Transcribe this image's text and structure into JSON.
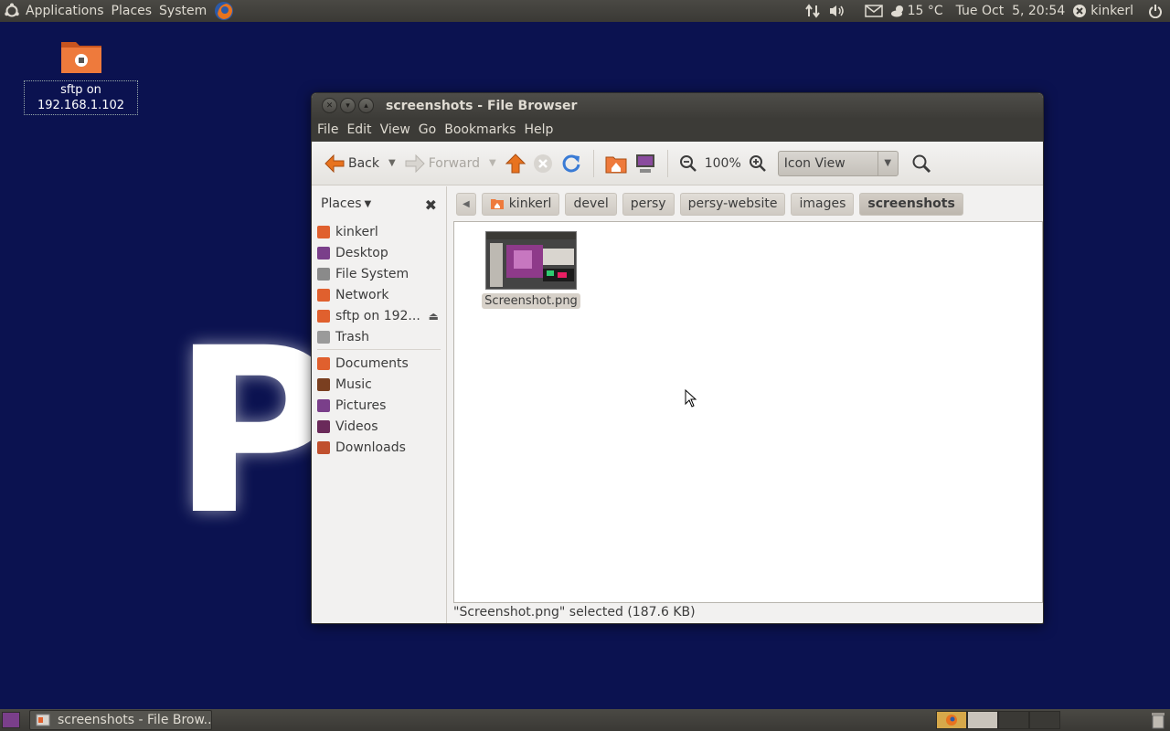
{
  "top_panel": {
    "applications": "Applications",
    "places": "Places",
    "system": "System",
    "weather": "15 °C",
    "clock": "Tue Oct  5, 20:54",
    "user": "kinkerl"
  },
  "desktop": {
    "icon_label": "sftp on 192.168.1.102",
    "wallpaper_letter": "P"
  },
  "window": {
    "title": "screenshots - File Browser",
    "menu": [
      "File",
      "Edit",
      "View",
      "Go",
      "Bookmarks",
      "Help"
    ],
    "toolbar": {
      "back": "Back",
      "forward": "Forward",
      "zoom": "100%",
      "view_mode": "Icon View"
    },
    "sidebar": {
      "header": "Places",
      "items": [
        {
          "label": "kinkerl",
          "icon": "home-folder-icon",
          "color": "#e0602e"
        },
        {
          "label": "Desktop",
          "icon": "desktop-icon",
          "color": "#7a3f8a"
        },
        {
          "label": "File System",
          "icon": "drive-icon",
          "color": "#8a8a8a"
        },
        {
          "label": "Network",
          "icon": "network-folder-icon",
          "color": "#e0602e"
        },
        {
          "label": "sftp on 192...",
          "icon": "remote-folder-icon",
          "color": "#e0602e"
        },
        {
          "label": "Trash",
          "icon": "trash-icon",
          "color": "#9a9a9a"
        }
      ],
      "bookmarks": [
        {
          "label": "Documents",
          "icon": "folder-icon",
          "color": "#e0602e"
        },
        {
          "label": "Music",
          "icon": "music-folder-icon",
          "color": "#7a3f20"
        },
        {
          "label": "Pictures",
          "icon": "pictures-folder-icon",
          "color": "#7a3f8a"
        },
        {
          "label": "Videos",
          "icon": "videos-folder-icon",
          "color": "#6a2a5a"
        },
        {
          "label": "Downloads",
          "icon": "downloads-folder-icon",
          "color": "#c0502e"
        }
      ]
    },
    "path": [
      "kinkerl",
      "devel",
      "persy",
      "persy-website",
      "images",
      "screenshots"
    ],
    "files": [
      {
        "name": "Screenshot.png"
      }
    ],
    "status": "\"Screenshot.png\" selected (187.6 KB)"
  },
  "taskbar": {
    "task": "screenshots - File Brow..."
  }
}
